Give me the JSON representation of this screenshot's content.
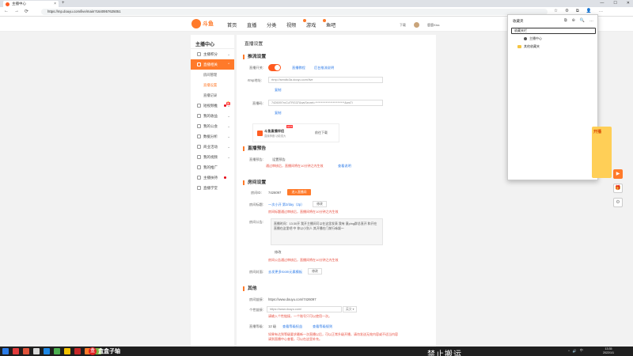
{
  "browser": {
    "tab_title": "主播中心",
    "tab_close": "×",
    "new_tab": "+",
    "window_controls": [
      "—",
      "☐",
      "✕"
    ],
    "nav": [
      "←",
      "→",
      "⟳"
    ],
    "url": "https://mp.douyu.com/live/main?1640957625051",
    "tool_icons": [
      "☆",
      "⚙",
      "⧉",
      "👤",
      "…"
    ]
  },
  "header": {
    "logo_text": "斗鱼",
    "nav": [
      "首页",
      "直播",
      "分类",
      "视频",
      "游戏",
      "鱼吧"
    ],
    "download": "下载",
    "username": "鹿鹿Kiss"
  },
  "sidebar": {
    "title": "主播中心",
    "items": [
      {
        "label": "主播积分",
        "type": "item"
      },
      {
        "label": "直播相关",
        "type": "item",
        "active": true
      },
      {
        "label": "房间管理",
        "type": "sub"
      },
      {
        "label": "直播设置",
        "type": "sub",
        "selected": true
      },
      {
        "label": "直播记录",
        "type": "sub"
      },
      {
        "label": "短视频推",
        "type": "item",
        "new": "新"
      },
      {
        "label": "我的收益",
        "type": "item"
      },
      {
        "label": "我的公会",
        "type": "item"
      },
      {
        "label": "数据分析",
        "type": "item"
      },
      {
        "label": "商业活动",
        "type": "item"
      },
      {
        "label": "我的视频",
        "type": "item"
      },
      {
        "label": "我的推广",
        "type": "item"
      },
      {
        "label": "主播扶持",
        "type": "item"
      },
      {
        "label": "直播学堂",
        "type": "item"
      }
    ]
  },
  "content": {
    "title": "直播设置",
    "push": {
      "section": "推流设置",
      "live_switch_label": "直播开关:",
      "link1": "直播教程",
      "link2": "后台推流说明",
      "rtmp_label": "rtmp地址:",
      "rtmp_value": "rtmp://sendtc3a.douyu.com/live",
      "copy1": "复制",
      "code_label": "直播码:",
      "code_value": "7426097rxCuTRG37&wsSecret=*************************&wsTi",
      "copy2": "复制",
      "tool_name": "斗鱼直播伴侣",
      "tool_hot": "HOT",
      "tool_sub": "直播神器 功能强大",
      "tool_download": "前往下载"
    },
    "preview": {
      "section": "直播预告",
      "label": "直播预告:",
      "value": "设置预告",
      "warn": "通过审核后，直播间将在10分钟之内生效",
      "link": "查看说明"
    },
    "room": {
      "section": "房间设置",
      "id_label": "房间ID:",
      "id_value": "7426097",
      "id_button": "进入直播间",
      "name_label": "房间标题:",
      "name_value": "一次小开 第2/day（2p）",
      "name_edit": "修改",
      "name_warn": "房间标题通过审核后，直播间将在10分钟之内生效",
      "notice_label": "房间公告:",
      "notice_text": "直播时间：13:30开 我开主播间可以在这里发表 我有 意ping群总直开 和开在直播在这里吧 中 你以小别人 其开播在门前行咏颖～",
      "notice_edit": "修改",
      "notice_warn": "房间公告通过审核后，直播间将在10分钟之内生效",
      "cover_label": "房间封面:",
      "cover_link": "去发更多room元素模板",
      "cover_edit": "修改"
    },
    "other": {
      "section": "其他",
      "room_url_label": "房间链接:",
      "room_url_value": "https://www.douyu.com/7426097",
      "custom_label": "个性链接:",
      "custom_value": "https://www.douyu.com/",
      "custom_select": "英文 ▾",
      "custom_warn": "请输入个性链接，一个账号只可以使用一次。",
      "level_label": "直播等级:",
      "level_value": "12 级",
      "level_link1": "查看等级权益",
      "level_link2": "查看等级规则",
      "level_warn": "如果有达到等级要求最新一次直播以后，可以正常升级开播，请勿发送无效内容或不适当内容",
      "level_warn2": "请到直播中心查看，可以在这里补充。"
    }
  },
  "favorites": {
    "title": "收藏夹",
    "icons": [
      "⧉",
      "⊕",
      "🔍",
      "…"
    ],
    "search_value": "收藏夹栏",
    "folder1": "收藏夹栏",
    "item1": "主播中心",
    "folder2": "其他收藏夹"
  },
  "side_widgets": {
    "promo": "开播",
    "buttons": [
      "▶",
      "🎁",
      "⚙"
    ]
  },
  "taskbar": {
    "brand_icon": "盒",
    "brand_text": "盒盒子轴",
    "banner": "禁止搬运",
    "tray": [
      "^",
      "🔊",
      "中"
    ],
    "time": "13:35",
    "date": "2022/1/1"
  },
  "colors": {
    "accent": "#ff7a2a",
    "link": "#2d7be8",
    "warn": "#e84c3d"
  }
}
